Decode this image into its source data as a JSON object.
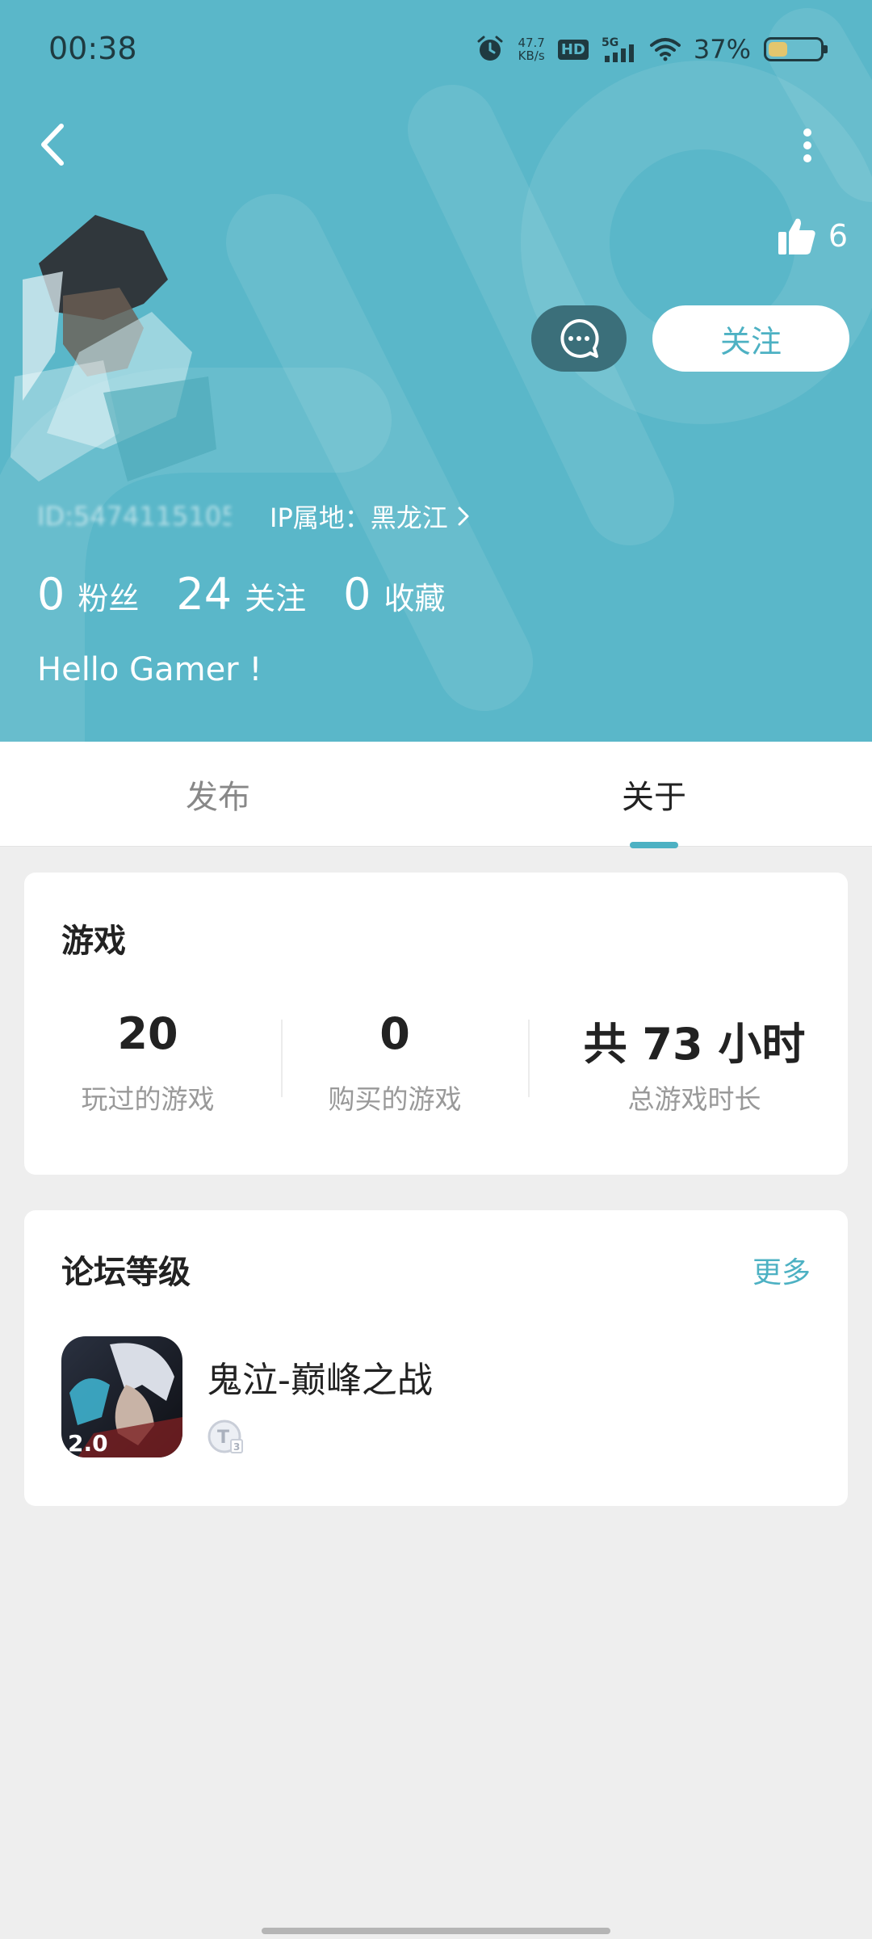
{
  "status_bar": {
    "time": "00:38",
    "net_speed_value": "47.7",
    "net_speed_unit": "KB/s",
    "hd": "HD",
    "signal": "5G",
    "battery_percent": "37%",
    "battery_level": 0.37
  },
  "header": {
    "likes": "6",
    "follow_label": "关注",
    "id_text": "ID:5474115105",
    "ip_location": "IP属地：黑龙江",
    "stats": [
      {
        "value": "0",
        "label": "粉丝"
      },
      {
        "value": "24",
        "label": "关注"
      },
      {
        "value": "0",
        "label": "收藏"
      }
    ],
    "bio": "Hello Gamer !",
    "bg_color": "#5ab7c9"
  },
  "tabs": [
    {
      "label": "发布",
      "active": false
    },
    {
      "label": "关于",
      "active": true
    }
  ],
  "games_card": {
    "title": "游戏",
    "stats": [
      {
        "value": "20",
        "label": "玩过的游戏"
      },
      {
        "value": "0",
        "label": "购买的游戏"
      },
      {
        "value": "共 73 小时",
        "label": "总游戏时长"
      }
    ]
  },
  "forum_card": {
    "title": "论坛等级",
    "more_label": "更多",
    "item": {
      "name": "鬼泣-巅峰之战",
      "icon_badge": "2.0",
      "level_icon": "level-t3-badge"
    }
  },
  "colors": {
    "accent": "#4db1c3",
    "header_bg": "#5ab7c9",
    "message_button": "#3b6f7a"
  }
}
